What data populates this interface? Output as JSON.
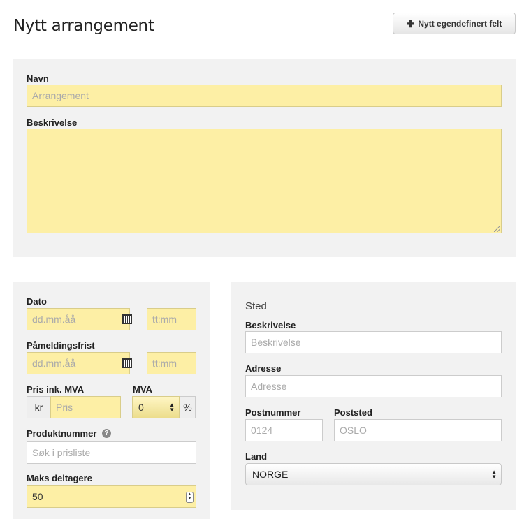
{
  "page": {
    "title": "Nytt arrangement",
    "new_field_button": "Nytt egendefinert felt"
  },
  "main_section": {
    "name_label": "Navn",
    "name_placeholder": "Arrangement",
    "description_label": "Beskrivelse",
    "description_value": ""
  },
  "details": {
    "date_label": "Dato",
    "date_placeholder": "dd.mm.åå",
    "time_placeholder": "tt:mm",
    "deadline_label": "Påmeldingsfrist",
    "deadline_date_placeholder": "dd.mm.åå",
    "deadline_time_placeholder": "tt:mm",
    "price_label": "Pris ink. MVA",
    "currency": "kr",
    "price_placeholder": "Pris",
    "vat_label": "MVA",
    "vat_value": "0",
    "vat_unit": "%",
    "product_number_label": "Produktnummer",
    "product_search_placeholder": "Søk i prisliste",
    "max_participants_label": "Maks deltagere",
    "max_participants_value": "50"
  },
  "location": {
    "title": "Sted",
    "description_label": "Beskrivelse",
    "description_placeholder": "Beskrivelse",
    "address_label": "Adresse",
    "address_placeholder": "Adresse",
    "postal_code_label": "Postnummer",
    "postal_code_placeholder": "0124",
    "city_label": "Poststed",
    "city_placeholder": "OSLO",
    "country_label": "Land",
    "country_value": "NORGE"
  },
  "colors": {
    "highlight_field": "#fdefa5",
    "panel_background": "#f2f2f2"
  },
  "icons": {
    "new_field": "plus-icon",
    "date_picker": "calendar-icon",
    "help": "question-icon",
    "select": "updown-arrows-icon"
  }
}
